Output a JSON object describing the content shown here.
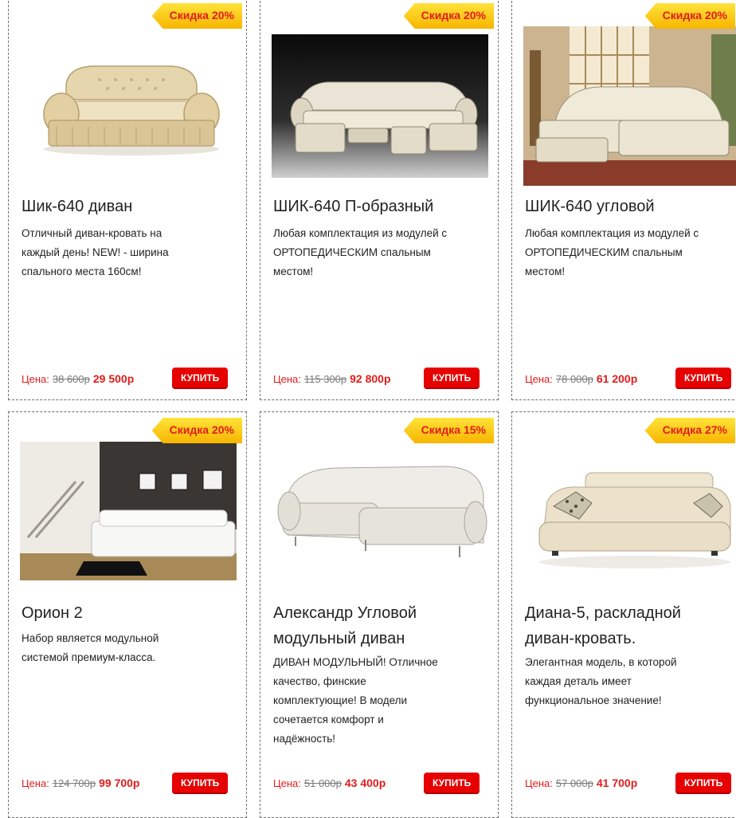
{
  "products": [
    {
      "badge": "Скидка 20%",
      "title_lines": [
        "Шик-640 диван"
      ],
      "desc_lines": [
        "Отличный диван-кровать на",
        "каждый день! NEW! - ширина",
        "спального места 160см!"
      ],
      "price_label": "Цена:",
      "old_price": "38 600р",
      "new_price": "29 500р",
      "buy_label": "КУПИТЬ"
    },
    {
      "badge": "Скидка 20%",
      "title_lines": [
        "ШИК-640 П-образный"
      ],
      "desc_lines": [
        "Любая комплектация из модулей с",
        "ОРТОПЕДИЧЕСКИМ спальным",
        "местом!"
      ],
      "price_label": "Цена:",
      "old_price": "115 300р",
      "new_price": "92 800р",
      "buy_label": "КУПИТЬ"
    },
    {
      "badge": "Скидка 20%",
      "title_lines": [
        "ШИК-640 угловой"
      ],
      "desc_lines": [
        "Любая комплектация из модулей с",
        "ОРТОПЕДИЧЕСКИМ спальным",
        "местом!"
      ],
      "price_label": "Цена:",
      "old_price": "78 000р",
      "new_price": "61 200р",
      "buy_label": "КУПИТЬ"
    },
    {
      "badge": "Скидка 20%",
      "title_lines": [
        "Орион 2"
      ],
      "desc_lines": [
        "Набор является модульной",
        "системой премиум-класса."
      ],
      "price_label": "Цена:",
      "old_price": "124 700р",
      "new_price": "99 700р",
      "buy_label": "КУПИТЬ"
    },
    {
      "badge": "Скидка 15%",
      "title_lines": [
        "Александр Угловой",
        "модульный диван"
      ],
      "desc_lines": [
        "ДИВАН МОДУЛЬНЫЙ! Отличное",
        "качество, финские",
        "комплектующие! В модели",
        "сочетается комфорт и",
        "надёжность!"
      ],
      "price_label": "Цена:",
      "old_price": "51 000р",
      "new_price": "43 400р",
      "buy_label": "КУПИТЬ"
    },
    {
      "badge": "Скидка 27%",
      "title_lines": [
        "Диана-5, раскладной",
        "диван-кровать."
      ],
      "desc_lines": [
        "Элегантная модель, в которой",
        "каждая деталь имеет",
        "функциональное значение!"
      ],
      "price_label": "Цена:",
      "old_price": "57 000р",
      "new_price": "41 700р",
      "buy_label": "КУПИТЬ"
    }
  ]
}
